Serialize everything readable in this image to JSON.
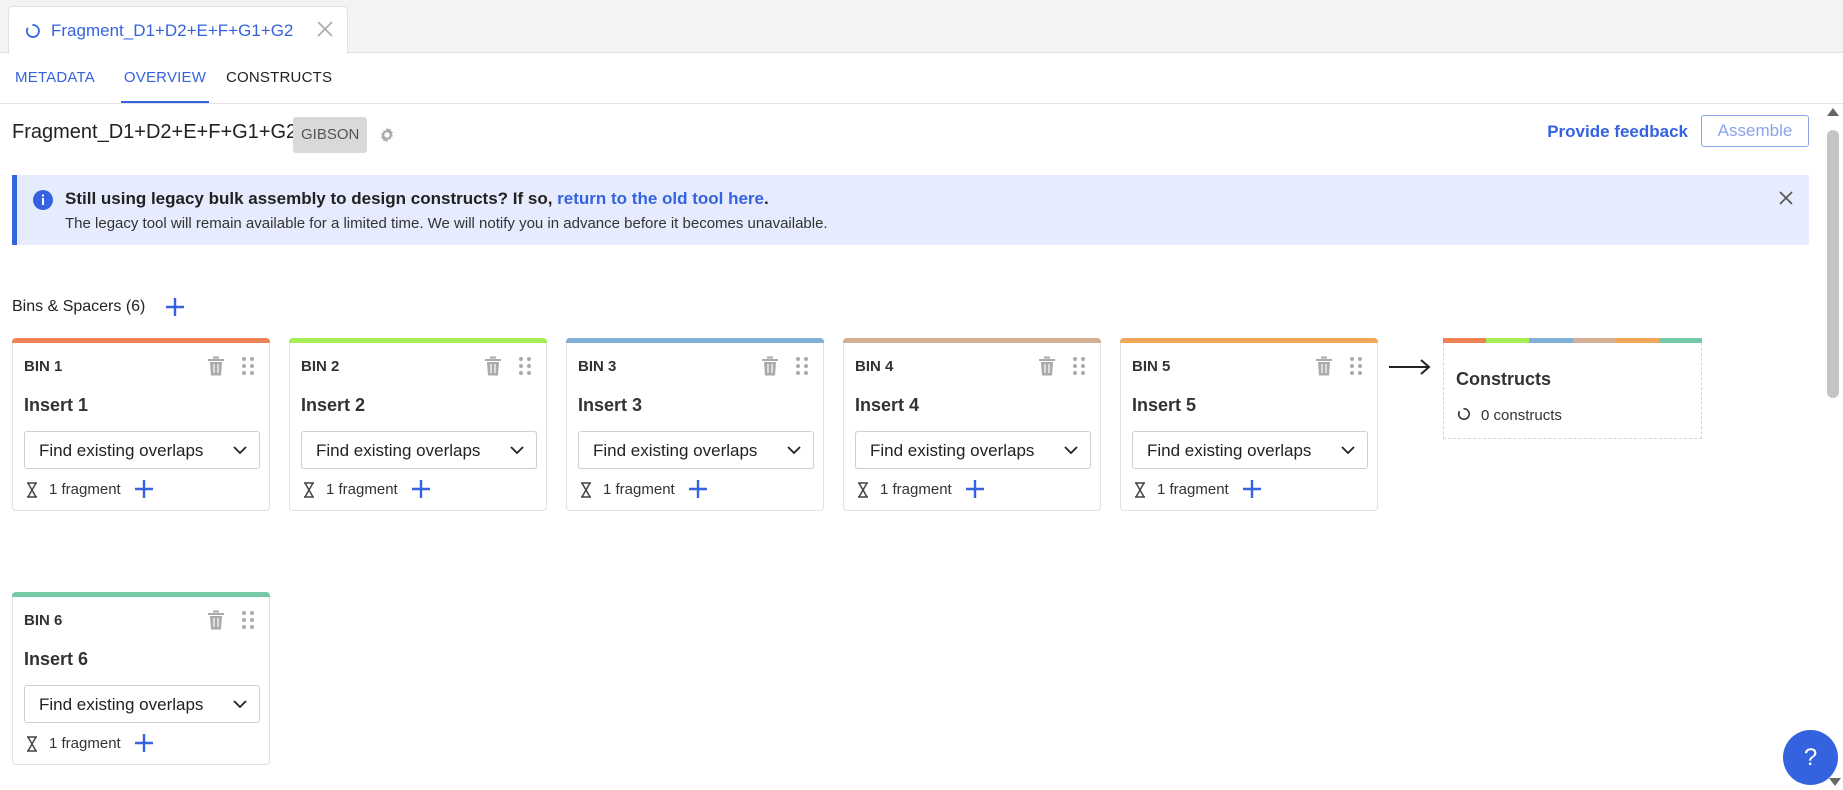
{
  "doc_tab": {
    "title": "Fragment_D1+D2+E+F+G1+G2"
  },
  "subtabs": {
    "metadata": "METADATA",
    "overview": "OVERVIEW",
    "constructs": "CONSTRUCTS"
  },
  "header": {
    "title": "Fragment_D1+D2+E+F+G1+G2",
    "method": "GIBSON",
    "feedback": "Provide feedback",
    "assemble": "Assemble"
  },
  "banner": {
    "question": "Still using legacy bulk assembly to design constructs? If so, ",
    "link": "return to the old tool here",
    "period": ".",
    "detail": "The legacy tool will remain available for a limited time. We will notify you in advance before it becomes unavailable."
  },
  "bins_header": {
    "label": "Bins & Spacers (6)"
  },
  "bins": [
    {
      "label": "BIN 1",
      "insert": "Insert 1",
      "select": "Find existing overlaps",
      "fragments": "1 fragment",
      "color": "#ee8455"
    },
    {
      "label": "BIN 2",
      "insert": "Insert 2",
      "select": "Find existing overlaps",
      "fragments": "1 fragment",
      "color": "#a6ee55"
    },
    {
      "label": "BIN 3",
      "insert": "Insert 3",
      "select": "Find existing overlaps",
      "fragments": "1 fragment",
      "color": "#80b0d8"
    },
    {
      "label": "BIN 4",
      "insert": "Insert 4",
      "select": "Find existing overlaps",
      "fragments": "1 fragment",
      "color": "#d4ae95"
    },
    {
      "label": "BIN 5",
      "insert": "Insert 5",
      "select": "Find existing overlaps",
      "fragments": "1 fragment",
      "color": "#f2a85a"
    },
    {
      "label": "BIN 6",
      "insert": "Insert 6",
      "select": "Find existing overlaps",
      "fragments": "1 fragment",
      "color": "#74c9a6"
    }
  ],
  "constructs_card": {
    "title": "Constructs",
    "count": "0 constructs"
  },
  "help": {
    "label": "?"
  },
  "colors": {
    "accent": "#3563e0",
    "banner_bg": "#e6ecfd"
  }
}
